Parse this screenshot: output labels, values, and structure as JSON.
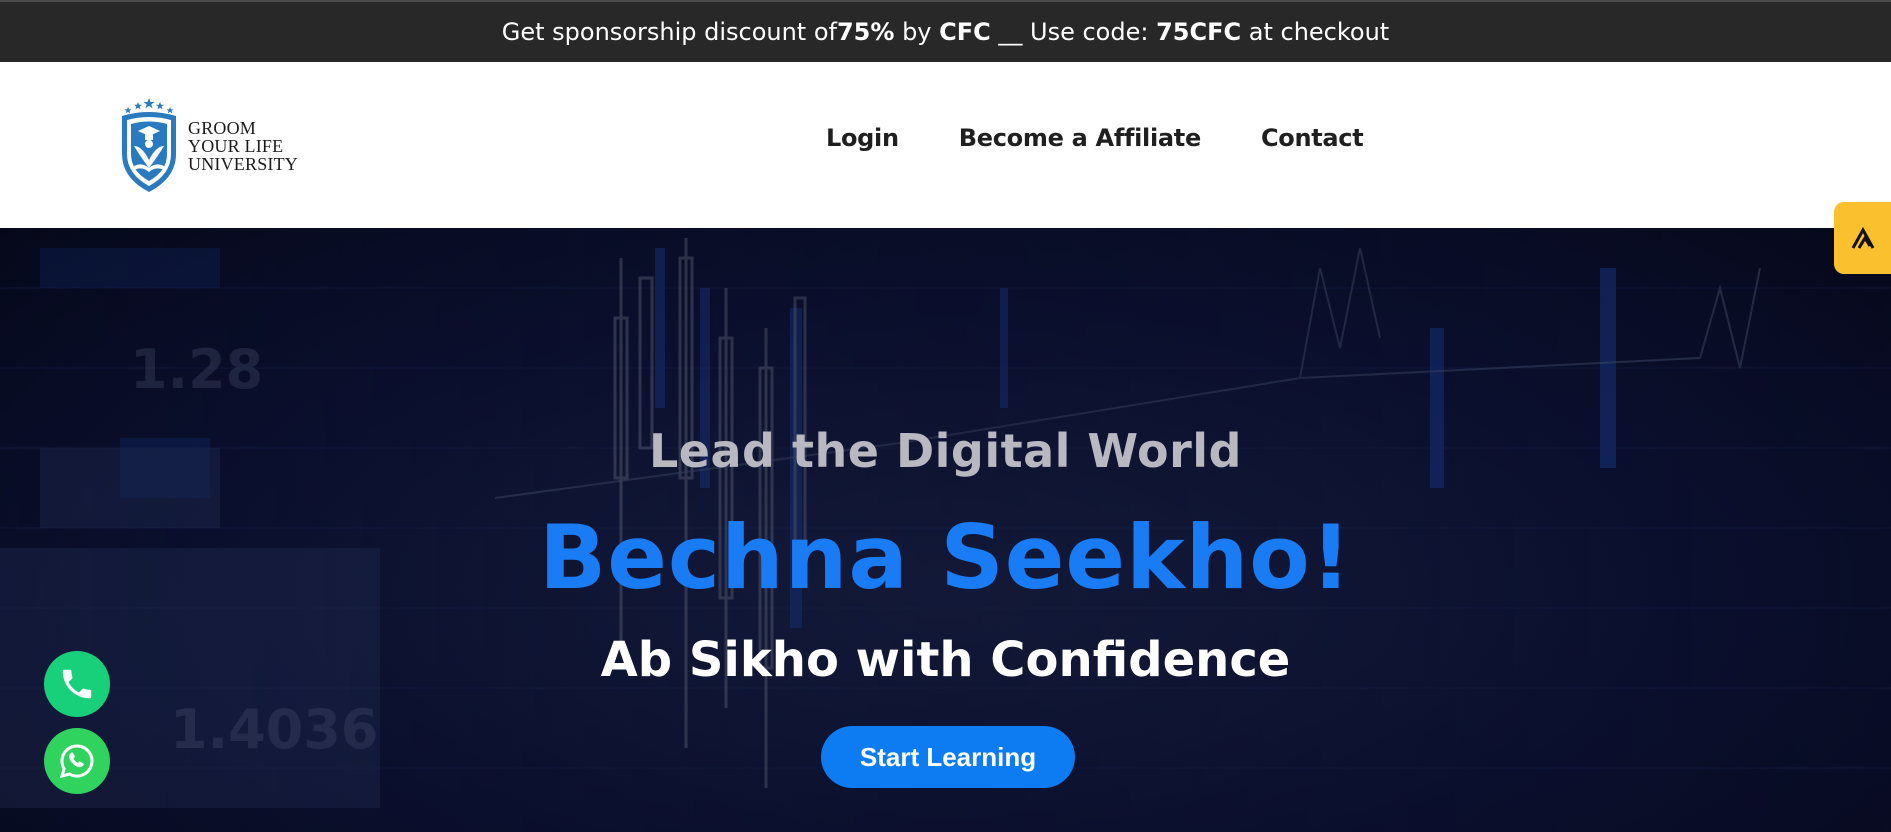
{
  "promo": {
    "text_1": "Get sponsorship discount of ",
    "discount": "75%",
    "text_2": " by ",
    "sponsor": "CFC",
    "text_3": " __ Use code: ",
    "code": "75CFC",
    "text_4": " at checkout"
  },
  "logo": {
    "line_1": "GROOM",
    "line_2": "YOUR LIFE",
    "line_3": "UNIVERSITY"
  },
  "nav": {
    "items": [
      {
        "label": "Login"
      },
      {
        "label": "Become a Affiliate"
      },
      {
        "label": "Contact"
      }
    ]
  },
  "hero": {
    "kicker": "Lead the Digital World",
    "title": "Bechna Seekho!",
    "subtitle": "Ab Sikho with Confidence",
    "cta_label": "Start Learning"
  },
  "colors": {
    "brand_blue": "#1a7cf5",
    "promo_bar": "#282828",
    "float_tab": "#fbc02d",
    "phone_button": "#19d07a",
    "whatsapp_button": "#2fd35e"
  },
  "icons": {
    "logo": "shield-logo-icon",
    "float_tab": "accessibility-icon",
    "phone": "phone-icon",
    "whatsapp": "whatsapp-icon"
  }
}
